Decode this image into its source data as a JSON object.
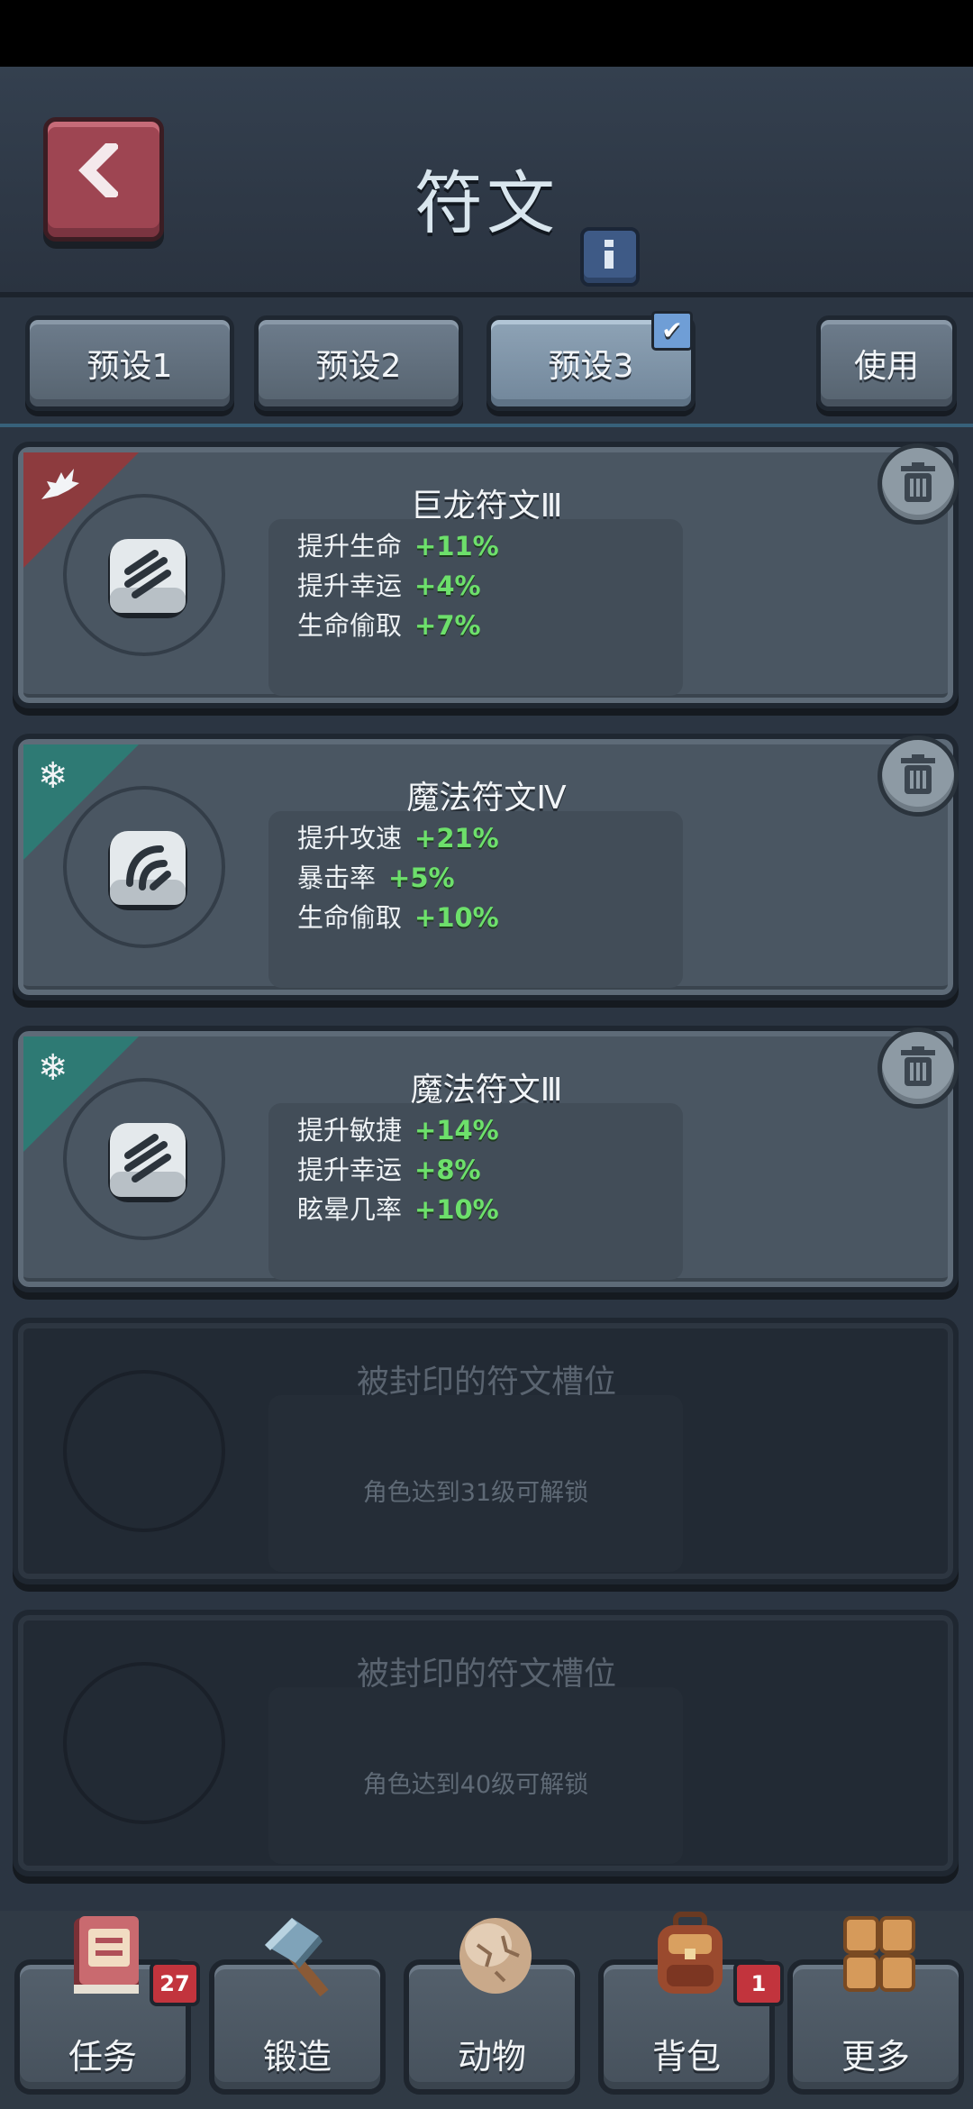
{
  "header": {
    "title": "符文",
    "back_icon": "chevron-left-icon",
    "info_icon": "info-icon"
  },
  "presets": {
    "items": [
      {
        "label": "预设1",
        "selected": false
      },
      {
        "label": "预设2",
        "selected": false
      },
      {
        "label": "预设3",
        "selected": true
      }
    ],
    "use_label": "使用",
    "check_glyph": "✔"
  },
  "slots": [
    {
      "name": "巨龙符文Ⅲ",
      "tag_icon": "dragon-icon",
      "tag_color": "#8d3b3e",
      "stats": [
        {
          "label": "提升生命",
          "value": "+11%"
        },
        {
          "label": "提升幸运",
          "value": "+4%"
        },
        {
          "label": "生命偷取",
          "value": "+7%"
        }
      ]
    },
    {
      "name": "魔法符文Ⅳ",
      "tag_icon": "snowflake-icon",
      "tag_color": "#2e7a74",
      "stats": [
        {
          "label": "提升攻速",
          "value": "+21%"
        },
        {
          "label": "暴击率",
          "value": "+5%"
        },
        {
          "label": "生命偷取",
          "value": "+10%"
        }
      ]
    },
    {
      "name": "魔法符文Ⅲ",
      "tag_icon": "snowflake-icon",
      "tag_color": "#2e7a74",
      "stats": [
        {
          "label": "提升敏捷",
          "value": "+14%"
        },
        {
          "label": "提升幸运",
          "value": "+8%"
        },
        {
          "label": "眩晕几率",
          "value": "+10%"
        }
      ]
    }
  ],
  "locked_slots": [
    {
      "name": "被封印的符文槽位",
      "hint": "角色达到31级可解锁"
    },
    {
      "name": "被封印的符文槽位",
      "hint": "角色达到40级可解锁"
    }
  ],
  "bottom_nav": [
    {
      "label": "任务",
      "icon": "quest-book-icon",
      "badge": "27"
    },
    {
      "label": "锻造",
      "icon": "hammer-icon",
      "badge": ""
    },
    {
      "label": "动物",
      "icon": "egg-icon",
      "badge": ""
    },
    {
      "label": "背包",
      "icon": "backpack-icon",
      "badge": "1"
    },
    {
      "label": "更多",
      "icon": "grid-menu-icon",
      "badge": ""
    }
  ],
  "colors": {
    "stat_value": "#6de06b",
    "badge": "#c2343d",
    "back_button": "#9e4552"
  }
}
